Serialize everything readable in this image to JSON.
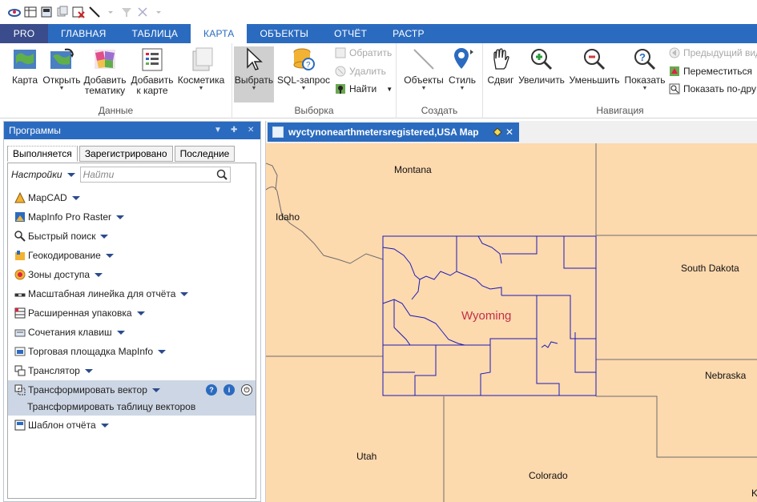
{
  "ribbon_tabs": [
    "PRO",
    "ГЛАВНАЯ",
    "ТАБЛИЦА",
    "КАРТА",
    "ОБЪЕКТЫ",
    "ОТЧЁТ",
    "РАСТР"
  ],
  "active_tab": "КАРТА",
  "groups": {
    "data": {
      "label": "Данные",
      "buttons": {
        "map": "Карта",
        "open": "Открыть",
        "add_thematic": "Добавить тематику",
        "add_to_map": "Добавить к карте",
        "cosmetics": "Косметика"
      }
    },
    "selection": {
      "label": "Выборка",
      "buttons": {
        "select": "Выбрать",
        "sql": "SQL-запрос",
        "invert": "Обратить",
        "delete": "Удалить",
        "find": "Найти"
      }
    },
    "create": {
      "label": "Создать",
      "buttons": {
        "objects": "Объекты",
        "style": "Стиль"
      }
    },
    "navigation": {
      "label": "Навигация",
      "buttons": {
        "pan": "Сдвиг",
        "zoom_in": "Увеличить",
        "zoom_out": "Уменьшить",
        "show": "Показать",
        "previous_view": "Предыдущий вид",
        "move": "Переместиться",
        "show_by": "Показать по-дру"
      }
    }
  },
  "programs_panel": {
    "title": "Программы",
    "tabs": [
      "Выполняется",
      "Зарегистрировано",
      "Последние"
    ],
    "settings_label": "Настройки",
    "search_placeholder": "Найти",
    "items": [
      "MapCAD",
      "MapInfo Pro Raster",
      "Быстрый поиск",
      "Геокодирование",
      "Зоны доступа",
      "Масштабная линейка для отчёта",
      "Расширенная упаковка",
      "Сочетания клавиш",
      "Торговая площадка MapInfo",
      "Транслятор",
      "Трансформировать вектор",
      "Шаблон отчёта"
    ],
    "selected_item_subtitle": "Трансформировать таблицу векторов"
  },
  "map_window": {
    "title": "wyctynonearthmetersregistered,USA Map",
    "labels": {
      "montana": "Montana",
      "idaho": "Idaho",
      "south_dakota": "South Dakota",
      "wyoming": "Wyoming",
      "nebraska": "Nebraska",
      "utah": "Utah",
      "colorado": "Colorado",
      "edge": "K"
    },
    "colors": {
      "land": "#fdd9ae",
      "county_lines": "#1a1ab8",
      "state_lines": "#6d6d6d",
      "wyoming_label": "#c0304a"
    }
  }
}
